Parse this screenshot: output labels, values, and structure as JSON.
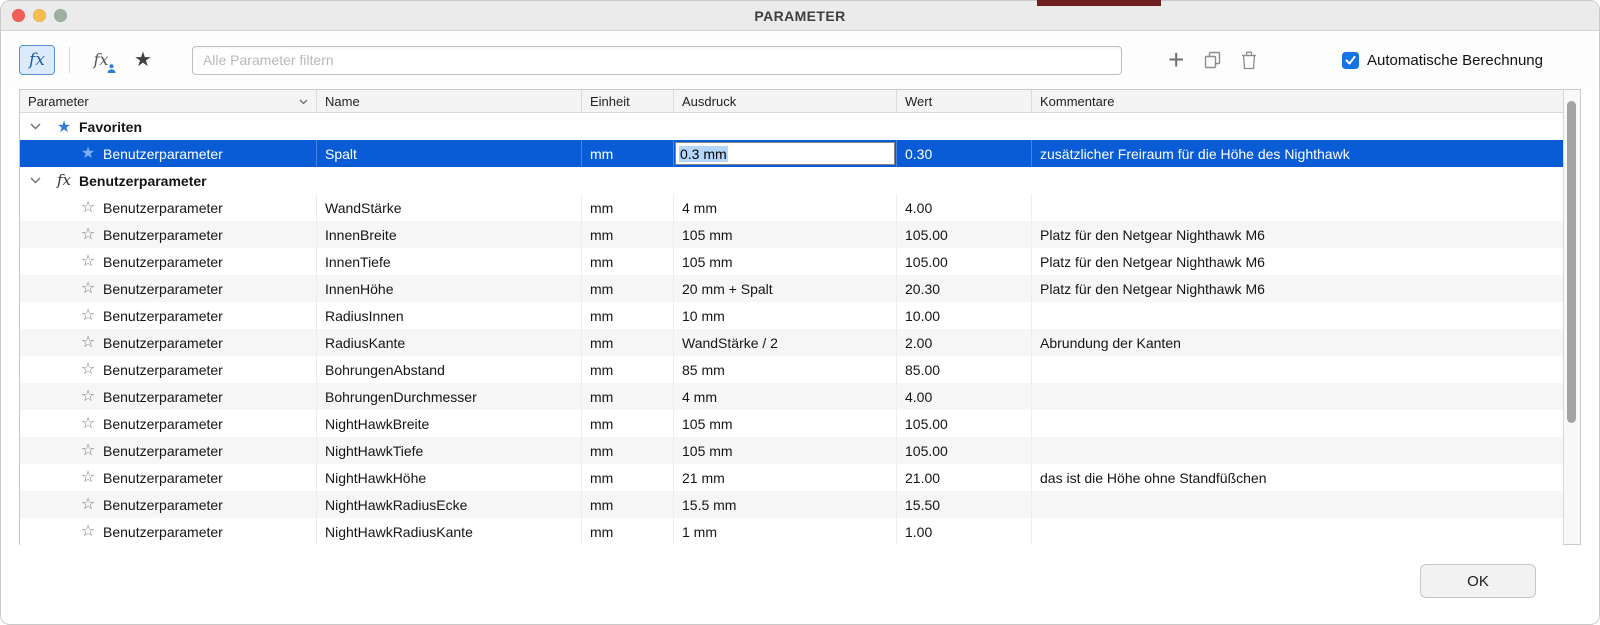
{
  "window": {
    "title": "PARAMETER"
  },
  "toolbar": {
    "filter_placeholder": "Alle Parameter filtern",
    "auto_compute_label": "Automatische Berechnung",
    "auto_compute_checked": true
  },
  "icons": {
    "fx": "fx",
    "star_filled": "★",
    "star_outline": "☆",
    "plus": "+"
  },
  "table": {
    "columns": [
      "Parameter",
      "Name",
      "Einheit",
      "Ausdruck",
      "Wert",
      "Kommentare"
    ],
    "rows": [
      {
        "type": "group",
        "icon": "star",
        "label": "Favoriten"
      },
      {
        "type": "param",
        "selected": true,
        "editing": true,
        "star": "filled",
        "parameter": "Benutzerparameter",
        "name": "Spalt",
        "einheit": "mm",
        "ausdruck": "0.3 mm",
        "wert": "0.30",
        "kommentar": "zusätzlicher Freiraum für die Höhe des Nighthawk"
      },
      {
        "type": "group",
        "icon": "fx",
        "label": "Benutzerparameter"
      },
      {
        "type": "param",
        "star": "outline",
        "parameter": "Benutzerparameter",
        "name": "WandStärke",
        "einheit": "mm",
        "ausdruck": "4 mm",
        "wert": "4.00",
        "kommentar": ""
      },
      {
        "type": "param",
        "star": "outline",
        "parameter": "Benutzerparameter",
        "name": "InnenBreite",
        "einheit": "mm",
        "ausdruck": "105 mm",
        "wert": "105.00",
        "kommentar": "Platz für den Netgear Nighthawk M6"
      },
      {
        "type": "param",
        "star": "outline",
        "parameter": "Benutzerparameter",
        "name": "InnenTiefe",
        "einheit": "mm",
        "ausdruck": "105 mm",
        "wert": "105.00",
        "kommentar": "Platz für den Netgear Nighthawk M6"
      },
      {
        "type": "param",
        "star": "outline",
        "parameter": "Benutzerparameter",
        "name": "InnenHöhe",
        "einheit": "mm",
        "ausdruck": "20 mm + Spalt",
        "wert": "20.30",
        "kommentar": "Platz für den Netgear Nighthawk M6"
      },
      {
        "type": "param",
        "star": "outline",
        "parameter": "Benutzerparameter",
        "name": "RadiusInnen",
        "einheit": "mm",
        "ausdruck": "10 mm",
        "wert": "10.00",
        "kommentar": ""
      },
      {
        "type": "param",
        "star": "outline",
        "parameter": "Benutzerparameter",
        "name": "RadiusKante",
        "einheit": "mm",
        "ausdruck": "WandStärke / 2",
        "wert": "2.00",
        "kommentar": "Abrundung der Kanten"
      },
      {
        "type": "param",
        "star": "outline",
        "parameter": "Benutzerparameter",
        "name": "BohrungenAbstand",
        "einheit": "mm",
        "ausdruck": "85 mm",
        "wert": "85.00",
        "kommentar": ""
      },
      {
        "type": "param",
        "star": "outline",
        "parameter": "Benutzerparameter",
        "name": "BohrungenDurchmesser",
        "einheit": "mm",
        "ausdruck": "4 mm",
        "wert": "4.00",
        "kommentar": ""
      },
      {
        "type": "param",
        "star": "outline",
        "parameter": "Benutzerparameter",
        "name": "NightHawkBreite",
        "einheit": "mm",
        "ausdruck": "105 mm",
        "wert": "105.00",
        "kommentar": ""
      },
      {
        "type": "param",
        "star": "outline",
        "parameter": "Benutzerparameter",
        "name": "NightHawkTiefe",
        "einheit": "mm",
        "ausdruck": "105 mm",
        "wert": "105.00",
        "kommentar": ""
      },
      {
        "type": "param",
        "star": "outline",
        "parameter": "Benutzerparameter",
        "name": "NightHawkHöhe",
        "einheit": "mm",
        "ausdruck": "21 mm",
        "wert": "21.00",
        "kommentar": "das ist die Höhe ohne Standfüßchen"
      },
      {
        "type": "param",
        "star": "outline",
        "parameter": "Benutzerparameter",
        "name": "NightHawkRadiusEcke",
        "einheit": "mm",
        "ausdruck": "15.5 mm",
        "wert": "15.50",
        "kommentar": ""
      },
      {
        "type": "param",
        "star": "outline",
        "parameter": "Benutzerparameter",
        "name": "NightHawkRadiusKante",
        "einheit": "mm",
        "ausdruck": "1 mm",
        "wert": "1.00",
        "kommentar": ""
      }
    ]
  },
  "footer": {
    "ok_label": "OK"
  },
  "colors": {
    "selection": "#0a5cd6",
    "selection_text": "#ffffff",
    "favorite_star": "#2f7bdb",
    "checkbox": "#1673e6",
    "text_selection": "#b3d7fb",
    "traffic_red": "#f35f58",
    "traffic_yellow": "#f5bd4e",
    "traffic_green": "#9fb0a0",
    "app_behind": "#6e1f1f"
  }
}
